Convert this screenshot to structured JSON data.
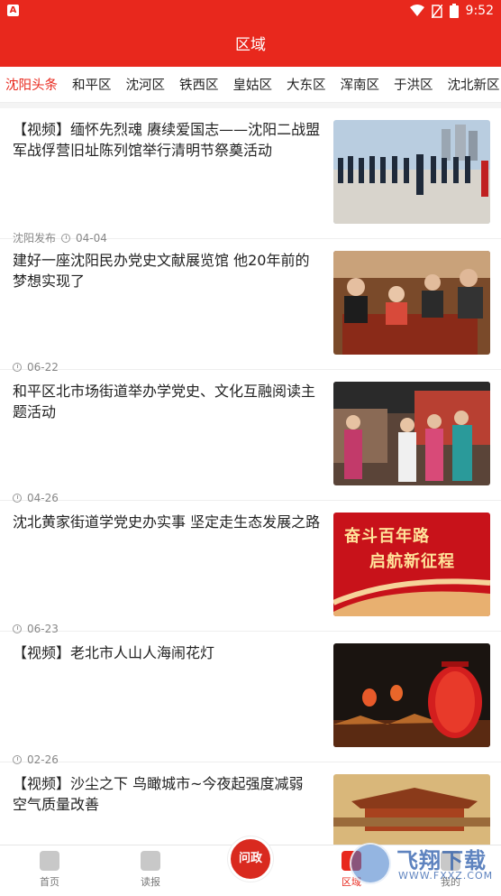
{
  "status_bar": {
    "time": "9:52",
    "app_icon": "A"
  },
  "header": {
    "title": "区域"
  },
  "tabs": [
    "沈阳头条",
    "和平区",
    "沈河区",
    "铁西区",
    "皇姑区",
    "大东区",
    "浑南区",
    "于洪区",
    "沈北新区"
  ],
  "articles": [
    {
      "title": "【视频】缅怀先烈魂 赓续爱国志——沈阳二战盟军战俘营旧址陈列馆举行清明节祭奠活动",
      "source": "沈阳发布",
      "date": "04-04"
    },
    {
      "title": "建好一座沈阳民办党史文献展览馆 他20年前的梦想实现了",
      "source": "",
      "date": "06-22"
    },
    {
      "title": "和平区北市场街道举办学党史、文化互融阅读主题活动",
      "source": "",
      "date": "04-26"
    },
    {
      "title": "沈北黄家街道学党史办实事 坚定走生态发展之路",
      "source": "",
      "date": "06-23",
      "thumb_text_1": "奋斗百年路",
      "thumb_text_2": "启航新征程"
    },
    {
      "title": "【视频】老北市人山人海闹花灯",
      "source": "",
      "date": "02-26"
    },
    {
      "title": "【视频】沙尘之下 鸟瞰城市~今夜起强度减弱 空气质量改善",
      "source": "",
      "date": ""
    }
  ],
  "bottom_nav": {
    "home": "首页",
    "read": "读报",
    "center": "问政",
    "region": "区域",
    "mine": "我的"
  },
  "watermark": {
    "text": "飞翔下载",
    "url": "WWW.FXXZ.COM"
  },
  "colors": {
    "brand": "#e8281d"
  }
}
